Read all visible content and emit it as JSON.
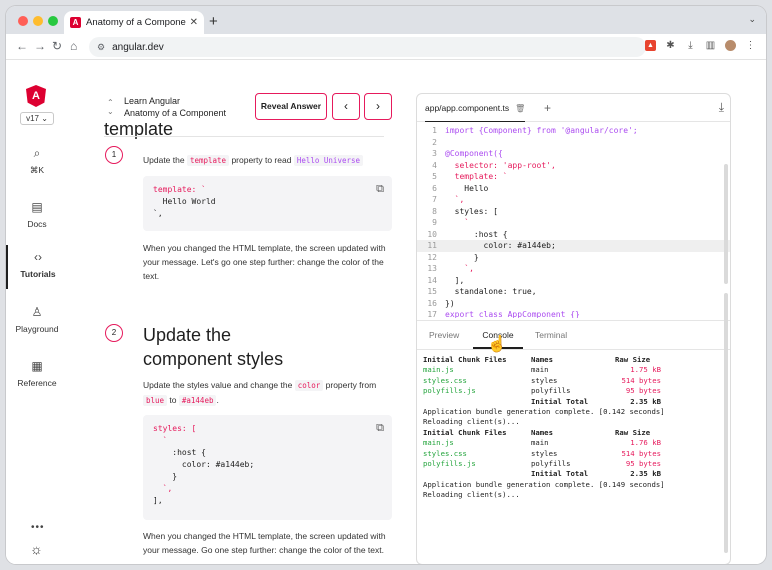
{
  "browser": {
    "tab_title": "Anatomy of a Component • Angular",
    "url": "angular.dev"
  },
  "leftnav": {
    "version": "v17 ⌄",
    "items": [
      {
        "label": "⌘K",
        "icon": "search-icon"
      },
      {
        "label": "Docs",
        "icon": "document-icon"
      },
      {
        "label": "Tutorials",
        "icon": "code-icon"
      },
      {
        "label": "Playground",
        "icon": "playground-icon"
      },
      {
        "label": "Reference",
        "icon": "reference-icon"
      }
    ]
  },
  "header": {
    "crumb_top": "Learn Angular",
    "crumb_title": "Anatomy of a Component",
    "reveal_label": "Reveal Answer"
  },
  "content": {
    "cut_heading": "template",
    "step1": {
      "num": "1",
      "text_a": "Update the ",
      "code_a": "template",
      "text_b": " property to read ",
      "code_b": "Hello Universe",
      "code_lines": [
        "template: `",
        "  Hello World",
        "`,"
      ],
      "after": "When you changed the HTML template, the screen updated with your message. Let's go one step further: change the color of the text."
    },
    "step2": {
      "num": "2",
      "heading_1": "Update the",
      "heading_2": "component styles",
      "text_a": "Update the styles value and change the ",
      "code_a": "color",
      "text_b": " property from ",
      "code_b": "blue",
      "text_c": " to ",
      "code_c": "#a144eb",
      "text_d": ".",
      "code_lines": [
        "styles: [",
        "  `",
        "    :host {",
        "      color: #a144eb;",
        "    }",
        "  `,",
        "],"
      ],
      "after": "When you changed the HTML template, the screen updated with your message. Go one step further: change the color of the text."
    }
  },
  "editor": {
    "file_tab": "app/app.component.ts",
    "lines": [
      {
        "n": "1",
        "t": "import {Component} from '@angular/core';"
      },
      {
        "n": "2",
        "t": ""
      },
      {
        "n": "3",
        "t": "@Component({"
      },
      {
        "n": "4",
        "t": "  selector: 'app-root',"
      },
      {
        "n": "5",
        "t": "  template: `"
      },
      {
        "n": "6",
        "t": "    Hello"
      },
      {
        "n": "7",
        "t": "  `,"
      },
      {
        "n": "8",
        "t": "  styles: ["
      },
      {
        "n": "9",
        "t": "    `"
      },
      {
        "n": "10",
        "t": "      :host {"
      },
      {
        "n": "11",
        "t": "        color: #a144eb;"
      },
      {
        "n": "12",
        "t": "      }"
      },
      {
        "n": "13",
        "t": "    `,"
      },
      {
        "n": "14",
        "t": "  ],"
      },
      {
        "n": "15",
        "t": "  standalone: true,"
      },
      {
        "n": "16",
        "t": "})"
      },
      {
        "n": "17",
        "t": "export class AppComponent {}"
      }
    ],
    "console_tabs": [
      "Preview",
      "Console",
      "Terminal"
    ],
    "console": [
      {
        "a": "Initial Chunk Files",
        "b": "Names",
        "c": "Raw Size",
        "kind": "head"
      },
      {
        "a": "main.js",
        "b": "main",
        "c": "1.75 kB",
        "kind": "file"
      },
      {
        "a": "styles.css",
        "b": "styles",
        "c": "514 bytes",
        "kind": "file"
      },
      {
        "a": "polyfills.js",
        "b": "polyfills",
        "c": "95 bytes",
        "kind": "file"
      },
      {
        "a": "",
        "b": "Initial Total",
        "c": "2.35 kB",
        "kind": "total"
      },
      {
        "a": "Application bundle generation complete. [0.142 seconds]",
        "b": "",
        "c": "",
        "kind": "msg"
      },
      {
        "a": "Reloading client(s)...",
        "b": "",
        "c": "",
        "kind": "msg"
      },
      {
        "a": "Initial Chunk Files",
        "b": "Names",
        "c": "Raw Size",
        "kind": "head"
      },
      {
        "a": "main.js",
        "b": "main",
        "c": "1.76 kB",
        "kind": "file"
      },
      {
        "a": "styles.css",
        "b": "styles",
        "c": "514 bytes",
        "kind": "file"
      },
      {
        "a": "polyfills.js",
        "b": "polyfills",
        "c": "95 bytes",
        "kind": "file"
      },
      {
        "a": "",
        "b": "Initial Total",
        "c": "2.35 kB",
        "kind": "total"
      },
      {
        "a": "Application bundle generation complete. [0.149 seconds]",
        "b": "",
        "c": "",
        "kind": "msg"
      },
      {
        "a": "Reloading client(s)...",
        "b": "",
        "c": "",
        "kind": "msg"
      }
    ]
  }
}
